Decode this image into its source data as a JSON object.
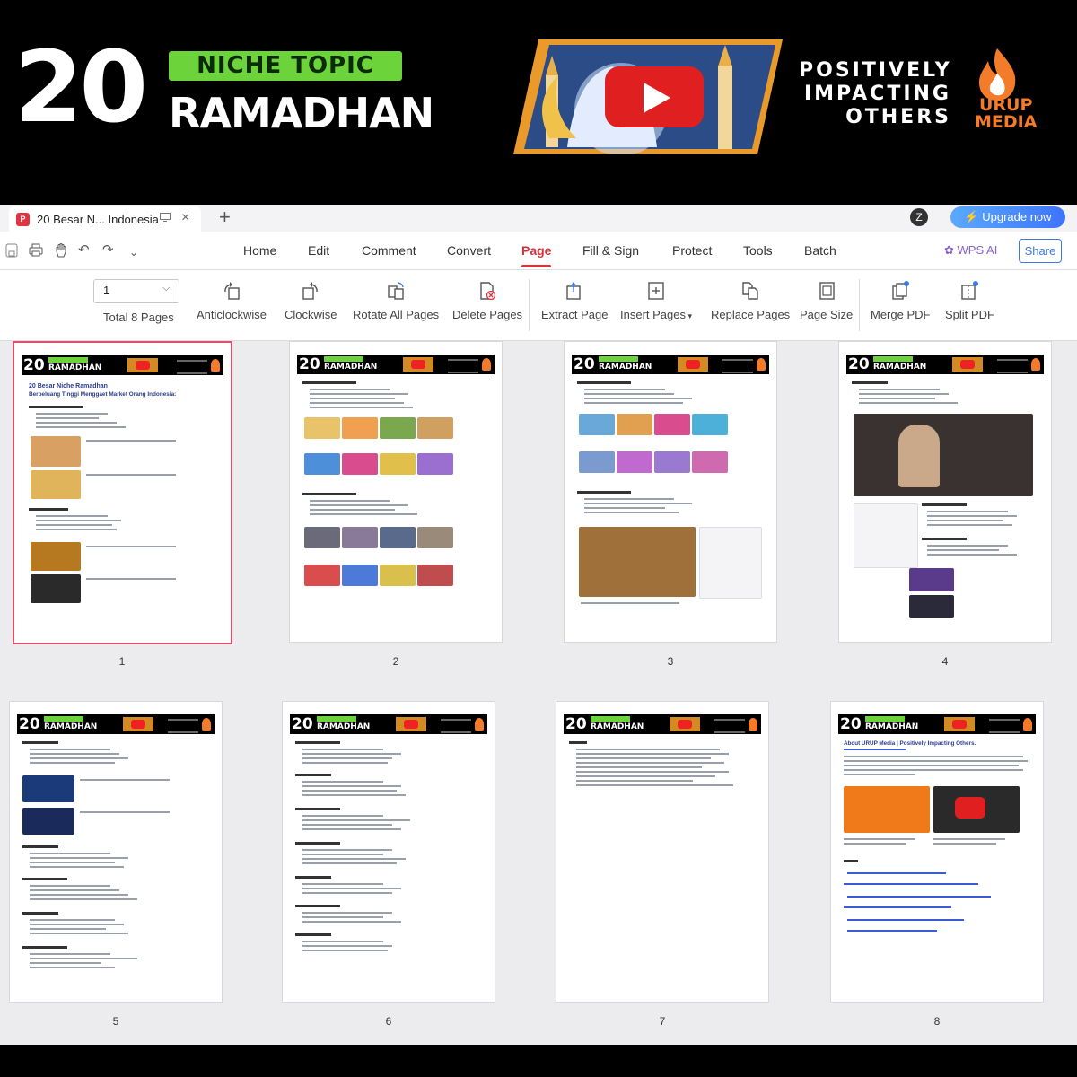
{
  "banner": {
    "number": "20",
    "badge": "NICHE TOPIC",
    "title": "RAMADHAN",
    "tagline": [
      "POSITIVELY",
      "IMPACTING",
      "OTHERS"
    ],
    "brand_line1": "URUP",
    "brand_line2": "MEDIA",
    "colors": {
      "badge": "#6dd33b",
      "brand": "#f47b2a",
      "youtube": "#e02020"
    }
  },
  "tab": {
    "title": "20 Besar N... Indonesia",
    "icon": "pdf-icon",
    "new_tab": "+"
  },
  "window": {
    "avatar": "Z",
    "upgrade": "⚡ Upgrade now"
  },
  "menu": {
    "items": [
      "Home",
      "Edit",
      "Comment",
      "Convert",
      "Page",
      "Fill & Sign",
      "Protect",
      "Tools",
      "Batch"
    ],
    "active": "Page",
    "wps_ai": "WPS AI",
    "share": "Share"
  },
  "ribbon": {
    "page_value": "1",
    "total": "Total 8 Pages",
    "tools": [
      "Anticlockwise",
      "Clockwise",
      "Rotate All Pages",
      "Delete Pages",
      "Extract Page",
      "Insert Pages",
      "Replace Pages",
      "Page Size",
      "Merge PDF",
      "Split PDF"
    ]
  },
  "thumbnails": {
    "pages": [
      "1",
      "2",
      "3",
      "4",
      "5",
      "6",
      "7",
      "8"
    ],
    "selected": "1",
    "page1_heading1": "20 Besar Niche Ramadhan",
    "page1_heading2": "Berpeluang Tinggi Menggaet Market Orang Indonesia:",
    "page8_heading": "About URUP Media | Positively Impacting Others."
  }
}
